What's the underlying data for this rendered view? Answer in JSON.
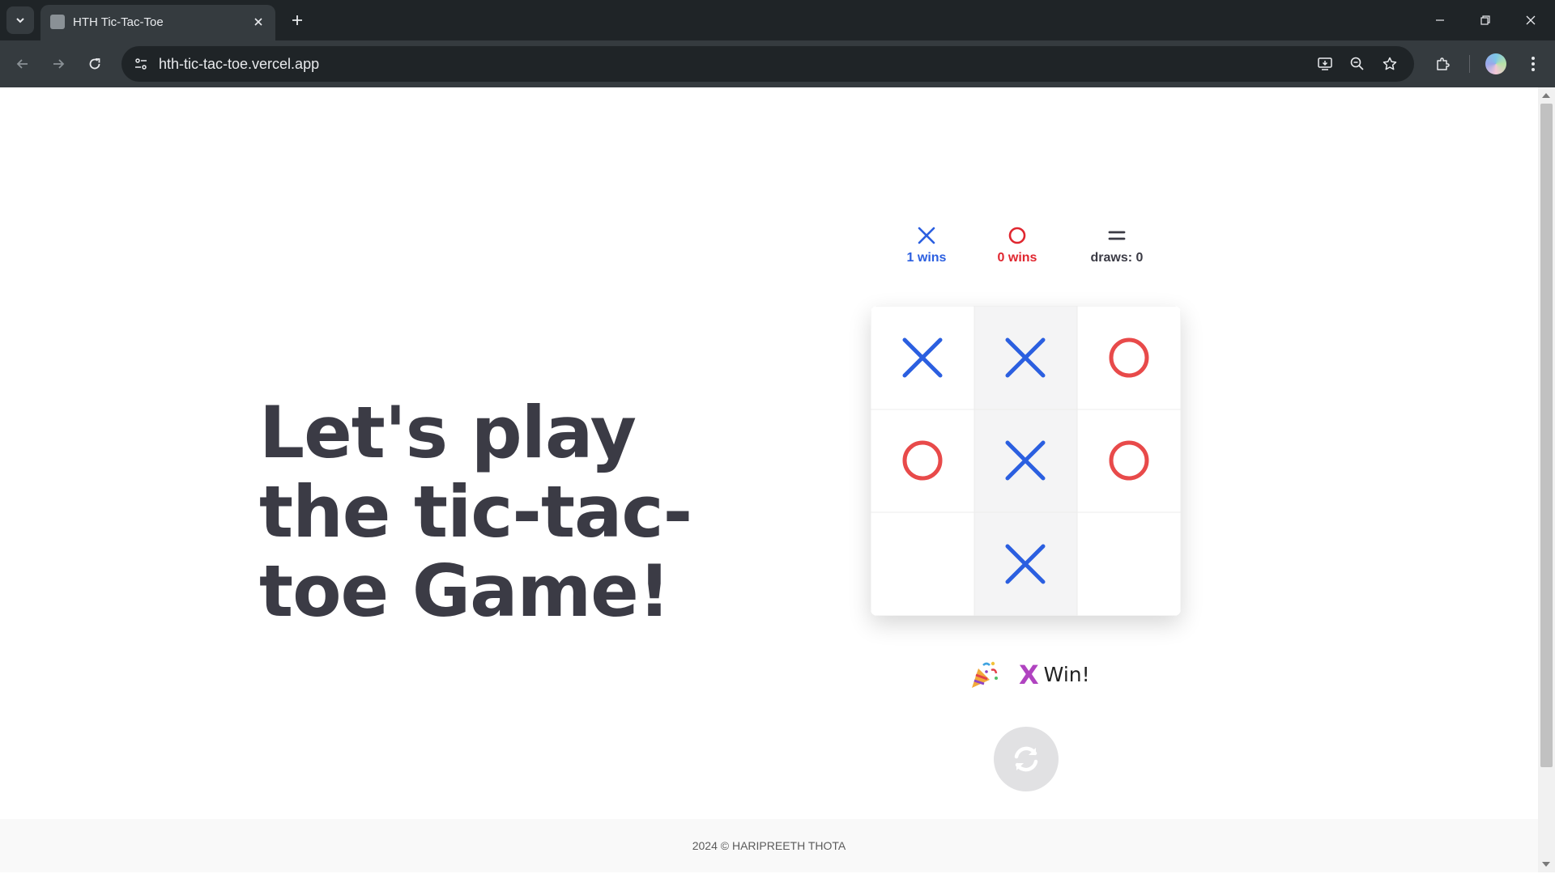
{
  "browser": {
    "tab_title": "HTH Tic-Tac-Toe",
    "url": "hth-tic-tac-toe.vercel.app"
  },
  "page": {
    "heading_lines": [
      "Let's play",
      "the tic-tac-",
      "toe Game!"
    ],
    "scoreboard": {
      "x": {
        "symbol": "X",
        "label": "1 wins",
        "color": "#2b5fe0"
      },
      "o": {
        "symbol": "O",
        "label": "0 wins",
        "color": "#e0262f"
      },
      "draws": {
        "symbol": "=",
        "label": "draws: 0",
        "color": "#3b3b45"
      }
    },
    "board": {
      "cells": [
        "X",
        "X",
        "O",
        "O",
        "X",
        "O",
        "",
        "X",
        ""
      ],
      "winning_line": [
        1,
        4,
        7
      ],
      "x_color": "#2b5fe0",
      "o_color": "#e84a4a"
    },
    "result": {
      "icon": "party-popper-icon",
      "winner": "X",
      "text": "Win!"
    },
    "restart_icon": "refresh-icon",
    "footer": "2024 © HARIPREETH THOTA"
  }
}
